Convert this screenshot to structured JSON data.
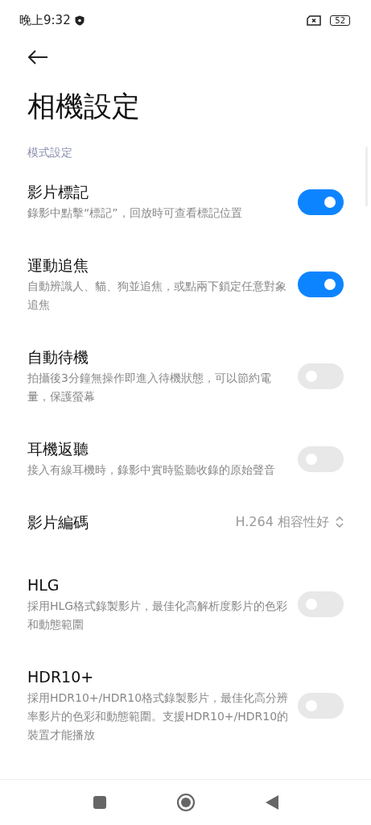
{
  "status_bar": {
    "time": "晚上9:32",
    "battery": "52"
  },
  "title": "相機設定",
  "section": "模式設定",
  "settings": [
    {
      "kind": "toggle",
      "title": "影片標記",
      "description": "錄影中點擊“標記”，回放時可查看標記位置",
      "on": true
    },
    {
      "kind": "toggle",
      "title": "運動追焦",
      "description": "自動辨識人、貓、狗並追焦，或點兩下鎖定任意對象追焦",
      "on": true
    },
    {
      "kind": "toggle",
      "title": "自動待機",
      "description": "拍攝後3分鐘無操作即進入待機狀態，可以節約電量，保護螢幕",
      "on": false
    },
    {
      "kind": "toggle",
      "title": "耳機返聽",
      "description": "接入有線耳機時，錄影中實時監聽收錄的原始聲音",
      "on": false
    },
    {
      "kind": "select",
      "title": "影片編碼",
      "value": "H.264 相容性好"
    },
    {
      "kind": "toggle",
      "title": "HLG",
      "description": "採用HLG格式錄製影片，最佳化高解析度影片的色彩和動態範圍",
      "on": false
    },
    {
      "kind": "toggle",
      "title": "HDR10+",
      "description": "採用HDR10+/HDR10格式錄製影片，最佳化高分辨率影片的色彩和動態範圍。支援HDR10+/HDR10的裝置才能播放",
      "on": false
    }
  ]
}
